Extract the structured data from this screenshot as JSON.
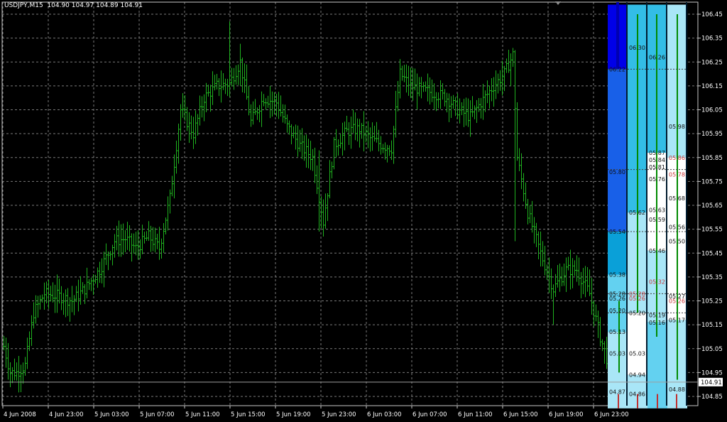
{
  "colors": {
    "background": "#000000",
    "grid": "#7a7a7a",
    "axis": "#c8c8c8",
    "bar": "#1fb21f",
    "text": "#ffffff",
    "current_price_line": "#9e9e9e",
    "panel_blue": [
      "#0000e8",
      "#1860e8",
      "#0aa0d8",
      "#33bde6",
      "#63d1f0",
      "#a9e6f7",
      "#ffffff"
    ],
    "panel_green": "#008a00",
    "panel_red": "#c03030",
    "panel_dark": "#001a2e"
  },
  "chart_data": {
    "type": "ohlc",
    "symbol_header": "USDJPY,M15  104.90 104.97 104.89 104.91",
    "ylim": [
      104.8,
      106.49
    ],
    "y_ticks": [
      "106.45",
      "106.35",
      "106.25",
      "106.15",
      "106.05",
      "105.95",
      "105.85",
      "105.75",
      "105.65",
      "105.55",
      "105.45",
      "105.35",
      "105.25",
      "105.15",
      "105.05",
      "104.95",
      "104.85"
    ],
    "x_labels": [
      "4 Jun 2008",
      "4 Jun 23:00",
      "5 Jun 03:00",
      "5 Jun 07:00",
      "5 Jun 11:00",
      "5 Jun 15:00",
      "5 Jun 19:00",
      "5 Jun 23:00",
      "6 Jun 03:00",
      "6 Jun 07:00",
      "6 Jun 11:00",
      "6 Jun 15:00",
      "6 Jun 19:00",
      "6 Jun 23:00"
    ],
    "current_price": 104.91,
    "current_price_label": "104.91",
    "grid": true,
    "close_anchors": [
      [
        0,
        105.06
      ],
      [
        3,
        104.95
      ],
      [
        6,
        104.95
      ],
      [
        10,
        104.98
      ],
      [
        14,
        105.2
      ],
      [
        19,
        105.28
      ],
      [
        26,
        105.27
      ],
      [
        32,
        105.25
      ],
      [
        38,
        105.3
      ],
      [
        45,
        105.38
      ],
      [
        52,
        105.5
      ],
      [
        57,
        105.51
      ],
      [
        62,
        105.47
      ],
      [
        68,
        105.52
      ],
      [
        73,
        105.47
      ],
      [
        78,
        105.68
      ],
      [
        83,
        106.05
      ],
      [
        89,
        105.95
      ],
      [
        94,
        106.1
      ],
      [
        100,
        106.15
      ],
      [
        106,
        106.16
      ],
      [
        111,
        106.25
      ],
      [
        116,
        106.0
      ],
      [
        122,
        106.1
      ],
      [
        128,
        106.08
      ],
      [
        133,
        105.98
      ],
      [
        139,
        105.9
      ],
      [
        145,
        105.85
      ],
      [
        150,
        105.58
      ],
      [
        155,
        105.9
      ],
      [
        161,
        105.96
      ],
      [
        167,
        105.97
      ],
      [
        172,
        105.93
      ],
      [
        178,
        105.9
      ],
      [
        182,
        105.89
      ],
      [
        186,
        106.2
      ],
      [
        191,
        106.15
      ],
      [
        197,
        106.13
      ],
      [
        202,
        106.12
      ],
      [
        208,
        106.1
      ],
      [
        213,
        106.05
      ],
      [
        219,
        106.02
      ],
      [
        224,
        106.08
      ],
      [
        230,
        106.15
      ],
      [
        235,
        106.2
      ],
      [
        239,
        106.28
      ],
      [
        241,
        105.85
      ],
      [
        246,
        105.62
      ],
      [
        252,
        105.45
      ],
      [
        258,
        105.3
      ],
      [
        264,
        105.38
      ],
      [
        269,
        105.38
      ],
      [
        275,
        105.28
      ],
      [
        280,
        105.1
      ],
      [
        285,
        104.95
      ],
      [
        288,
        104.91
      ]
    ],
    "spikes": [
      {
        "i": 106,
        "high": 106.42
      },
      {
        "i": 125,
        "high": 106.15
      },
      {
        "i": 148,
        "high": 105.88,
        "low": 105.54
      },
      {
        "i": 240,
        "high": 106.3,
        "low": 105.5
      },
      {
        "i": 258,
        "low": 105.15
      }
    ]
  },
  "side_panel": {
    "columns": [
      {
        "col": 0,
        "labels": [
          {
            "t": "06.22",
            "p": 106.22
          },
          {
            "t": "05.80",
            "p": 105.79
          },
          {
            "t": "05.54",
            "p": 105.54
          },
          {
            "t": "05.38",
            "p": 105.36
          },
          {
            "t": "05.28",
            "p": 105.28
          },
          {
            "t": "05.26",
            "p": 105.26
          },
          {
            "t": "05.20",
            "p": 105.21
          },
          {
            "t": "05.13",
            "p": 105.12
          },
          {
            "t": "05.03",
            "p": 105.03
          },
          {
            "t": "04.87",
            "p": 104.87
          }
        ]
      },
      {
        "col": 1,
        "labels": [
          {
            "t": "06.30",
            "p": 106.31
          },
          {
            "t": "05.62",
            "p": 105.62
          },
          {
            "t": "05.28",
            "p": 105.28
          },
          {
            "t": "05.26",
            "p": 105.26
          },
          {
            "t": "05.20",
            "p": 105.2
          },
          {
            "t": "05.03",
            "p": 105.03
          },
          {
            "t": "04.94",
            "p": 104.94
          },
          {
            "t": "04.86",
            "p": 104.86
          }
        ]
      },
      {
        "col": 2,
        "labels": [
          {
            "t": "06.26",
            "p": 106.27
          },
          {
            "t": "05.87",
            "p": 105.87
          },
          {
            "t": "05.84",
            "p": 105.84
          },
          {
            "t": "05.81",
            "p": 105.81
          },
          {
            "t": "05.76",
            "p": 105.76
          },
          {
            "t": "05.63",
            "p": 105.63
          },
          {
            "t": "05.59",
            "p": 105.59
          },
          {
            "t": "05.46",
            "p": 105.46
          },
          {
            "t": "05.32",
            "p": 105.33
          },
          {
            "t": "05.19",
            "p": 105.19
          },
          {
            "t": "05.16",
            "p": 105.16
          }
        ]
      },
      {
        "col": 3,
        "labels": [
          {
            "t": "05.98",
            "p": 105.98
          },
          {
            "t": "05.86",
            "p": 105.85
          },
          {
            "t": "05.78",
            "p": 105.78
          },
          {
            "t": "05.68",
            "p": 105.68
          },
          {
            "t": "05.56",
            "p": 105.56
          },
          {
            "t": "05.50",
            "p": 105.5
          },
          {
            "t": "05.27",
            "p": 105.27
          },
          {
            "t": "05.26",
            "p": 105.25
          },
          {
            "t": "05.17",
            "p": 105.17
          },
          {
            "t": "04.88",
            "p": 104.88
          }
        ]
      }
    ]
  }
}
